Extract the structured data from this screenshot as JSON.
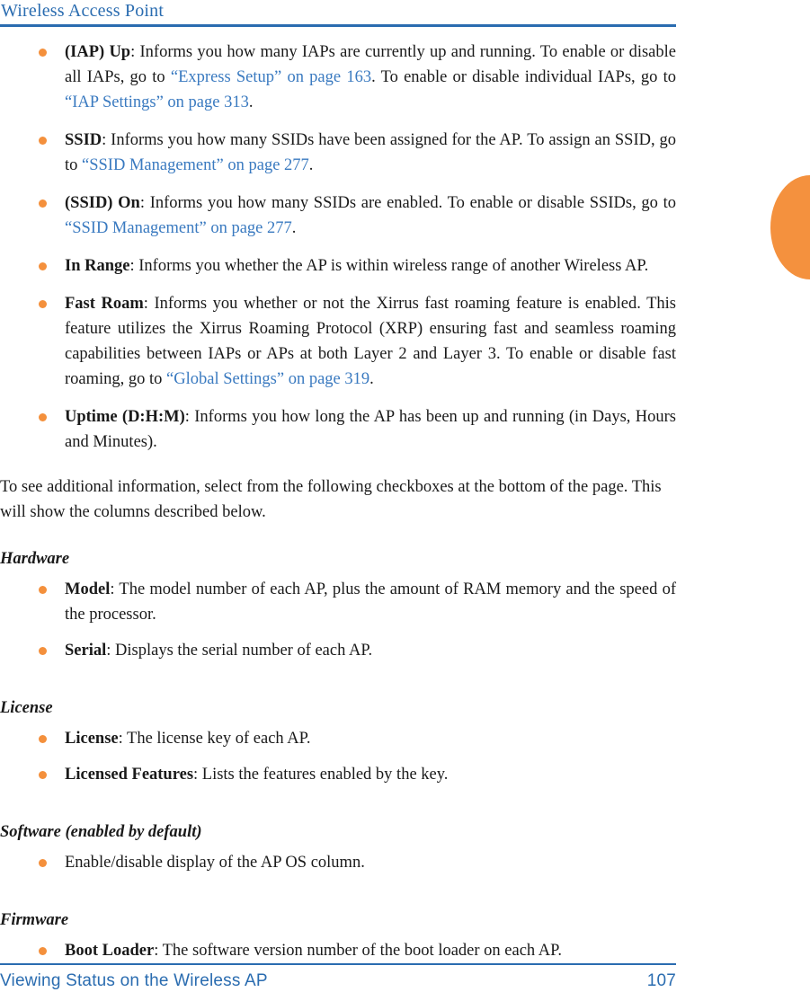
{
  "header": {
    "title": "Wireless Access Point",
    "rule_color": "#2a6cb0"
  },
  "colors": {
    "heading_blue": "#2a6cb0",
    "link_blue": "#3a7ac0",
    "bullet_orange": "#f4903c",
    "thumb_tab_orange": "#f4913e",
    "body_text": "#1a1a1a"
  },
  "main": {
    "status_bullets": [
      {
        "term": "(IAP) Up",
        "segments": [
          {
            "type": "text",
            "value": ": Informs you how many IAPs are currently up and running. To enable or disable all IAPs, go to "
          },
          {
            "type": "link",
            "value": "“Express Setup” on page 163"
          },
          {
            "type": "text",
            "value": ". To enable or disable individual IAPs, go to "
          },
          {
            "type": "link",
            "value": "“IAP Settings” on page 313"
          },
          {
            "type": "text",
            "value": "."
          }
        ]
      },
      {
        "term": "SSID",
        "segments": [
          {
            "type": "text",
            "value": ": Informs you how many SSIDs have been assigned for the AP. To assign an SSID, go to "
          },
          {
            "type": "link",
            "value": "“SSID Management” on page 277"
          },
          {
            "type": "text",
            "value": "."
          }
        ]
      },
      {
        "term": "(SSID) On",
        "segments": [
          {
            "type": "text",
            "value": ": Informs you how many SSIDs are enabled. To enable or disable SSIDs, go to "
          },
          {
            "type": "link",
            "value": "“SSID Management” on page 277"
          },
          {
            "type": "text",
            "value": "."
          }
        ]
      },
      {
        "term": "In Range",
        "segments": [
          {
            "type": "text",
            "value": ": Informs you whether the AP is within wireless range of another Wireless AP."
          }
        ]
      },
      {
        "term": "Fast Roam",
        "segments": [
          {
            "type": "text",
            "value": ": Informs you whether or not the Xirrus fast roaming feature is enabled. This feature utilizes the Xirrus Roaming Protocol (XRP) ensuring fast and seamless roaming capabilities between IAPs or APs at both Layer 2 and Layer 3. To enable or disable fast roaming, go to "
          },
          {
            "type": "link",
            "value": "“Global Settings” on page 319"
          },
          {
            "type": "text",
            "value": "."
          }
        ]
      },
      {
        "term": "Uptime (D:H:M)",
        "segments": [
          {
            "type": "text",
            "value": ": Informs you how long the AP has been up and running (in Days, Hours and Minutes)."
          }
        ]
      }
    ],
    "intro_paragraph": "To see additional information, select from the following checkboxes at the bottom of the page. This will show the columns described below.",
    "sections": [
      {
        "heading": "Hardware",
        "bullets": [
          {
            "term": "Model",
            "segments": [
              {
                "type": "text",
                "value": ": The model number of each AP, plus the amount of RAM memory and the speed of the processor."
              }
            ]
          },
          {
            "term": "Serial",
            "segments": [
              {
                "type": "text",
                "value": ": Displays the serial number of each AP."
              }
            ]
          }
        ]
      },
      {
        "heading": "License",
        "bullets": [
          {
            "term": "License",
            "segments": [
              {
                "type": "text",
                "value": ": The license key of each AP."
              }
            ]
          },
          {
            "term": "Licensed Features",
            "segments": [
              {
                "type": "text",
                "value": ": Lists the features enabled by the key."
              }
            ]
          }
        ]
      },
      {
        "heading": "Software (enabled by default)",
        "bullets": [
          {
            "term": "",
            "segments": [
              {
                "type": "text",
                "value": "Enable/disable display of the AP OS column."
              }
            ]
          }
        ]
      },
      {
        "heading": "Firmware",
        "bullets": [
          {
            "term": "Boot Loader",
            "segments": [
              {
                "type": "text",
                "value": ": The software version number of the boot loader on each AP."
              }
            ]
          }
        ]
      }
    ]
  },
  "footer": {
    "title": "Viewing Status on the Wireless AP",
    "page_number": "107"
  }
}
